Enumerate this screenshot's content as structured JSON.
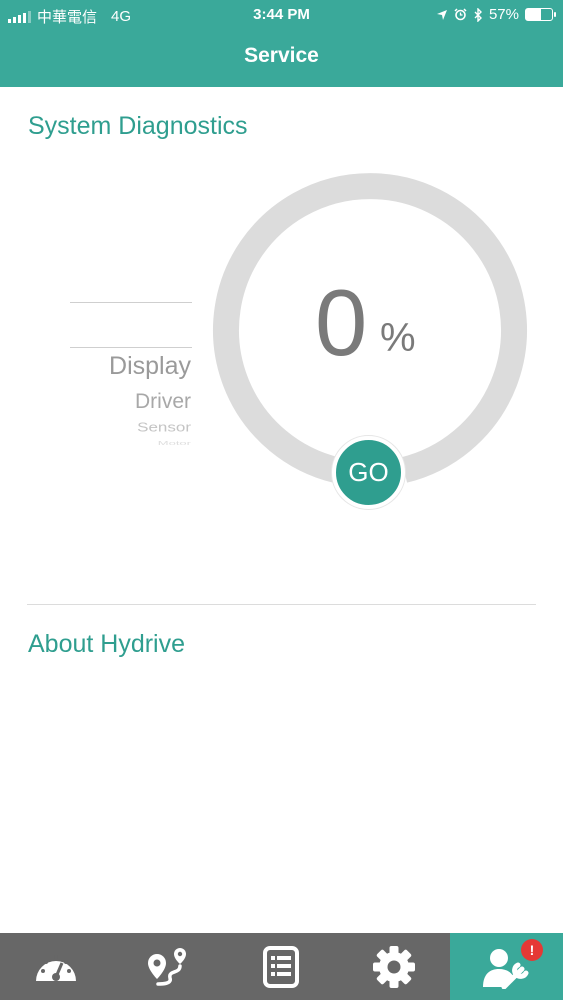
{
  "status_bar": {
    "carrier": "中華電信",
    "network": "4G",
    "time": "3:44 PM",
    "battery": "57%",
    "battery_level": 0.57
  },
  "header": {
    "title": "Service"
  },
  "diagnostics": {
    "title": "System Diagnostics",
    "picker_items": [
      "Display",
      "Driver",
      "Sensor",
      "Motor"
    ],
    "percent_value": "0",
    "percent_sign": "%",
    "progress": 0,
    "go_label": "GO"
  },
  "about": {
    "title": "About Hydrive"
  },
  "tabs": [
    {
      "icon": "speedometer-icon",
      "active": false
    },
    {
      "icon": "route-icon",
      "active": false
    },
    {
      "icon": "list-document-icon",
      "active": false
    },
    {
      "icon": "gear-icon",
      "active": false
    },
    {
      "icon": "user-wrench-icon",
      "active": true,
      "badge": "!"
    }
  ],
  "colors": {
    "accent": "#3aa99a",
    "accent_dark": "#2f9e8f",
    "tabbar": "#676767",
    "gauge_track": "#dcdcdc",
    "badge": "#e53935"
  }
}
